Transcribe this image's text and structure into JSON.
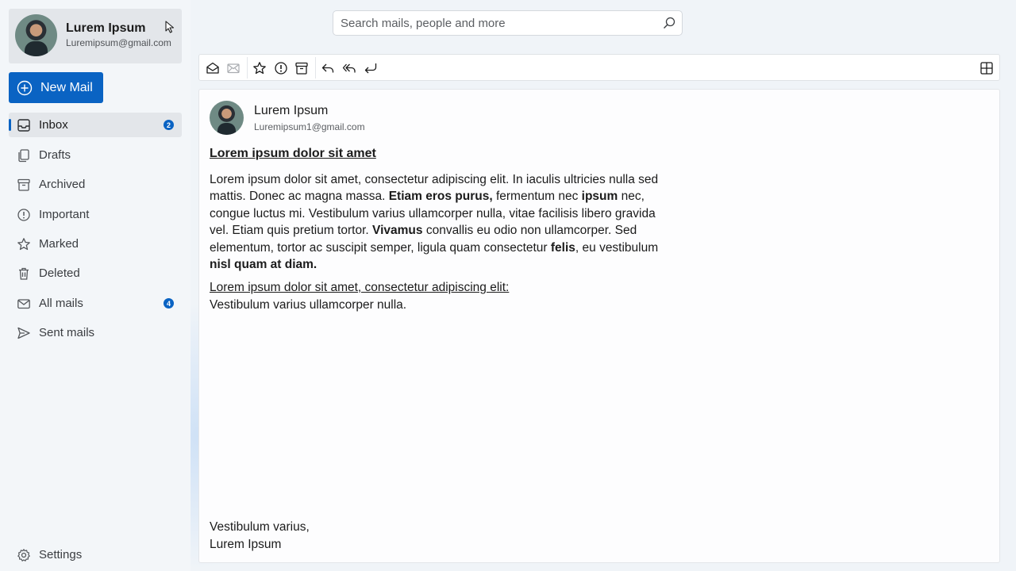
{
  "profile": {
    "name": "Lurem Ipsum",
    "email": "Luremipsum@gmail.com"
  },
  "new_mail_label": "New Mail",
  "nav": {
    "items": [
      {
        "label": "Inbox",
        "icon": "inbox-icon",
        "badge": "2"
      },
      {
        "label": "Drafts",
        "icon": "drafts-icon"
      },
      {
        "label": "Archived",
        "icon": "archive-icon"
      },
      {
        "label": "Important",
        "icon": "important-icon"
      },
      {
        "label": "Marked",
        "icon": "star-icon"
      },
      {
        "label": "Deleted",
        "icon": "trash-icon"
      },
      {
        "label": "All mails",
        "icon": "mail-icon",
        "badge": "4"
      },
      {
        "label": "Sent mails",
        "icon": "send-icon"
      }
    ],
    "settings_label": "Settings"
  },
  "search": {
    "placeholder": "Search mails, people and more"
  },
  "toolbar": {
    "icons": [
      "mark-read-icon",
      "mark-unread-icon",
      "star-icon",
      "important-icon",
      "archive-icon",
      "reply-icon",
      "reply-all-icon",
      "forward-icon",
      "layout-icon"
    ]
  },
  "mail": {
    "sender_name": "Lurem Ipsum",
    "sender_email": "Luremipsum1@gmail.com",
    "subject": "Lorem ipsum dolor sit amet",
    "body": {
      "p1_a": "Lorem ipsum dolor sit amet, consectetur adipiscing elit. In iaculis ultricies nulla sed mattis. Donec ac magna massa. ",
      "p1_b": "Etiam eros purus,",
      "p1_c": " fermentum nec ",
      "p1_d": "ipsum",
      "p1_e": " nec, congue luctus mi. Vestibulum varius ullamcorper nulla, vitae facilisis libero gravida vel. Etiam quis pretium tortor. ",
      "p1_f": "Vivamus",
      "p1_g": " convallis eu odio non ullamcorper. Sed elementum, tortor ac suscipit semper, ligula quam consectetur ",
      "p1_h": "felis",
      "p1_i": ", eu vestibulum ",
      "p1_j": "nisl quam at diam."
    },
    "link_line": "Lorem ipsum dolor sit amet, consectetur adipiscing elit:",
    "plain_line": "Vestibulum varius ullamcorper nulla.",
    "signature_line1": "Vestibulum varius,",
    "signature_line2": "Lurem Ipsum"
  },
  "colors": {
    "accent": "#0a63c3",
    "sidebar_bg": "#f3f6f9",
    "active_bg": "#e3e6ea"
  }
}
